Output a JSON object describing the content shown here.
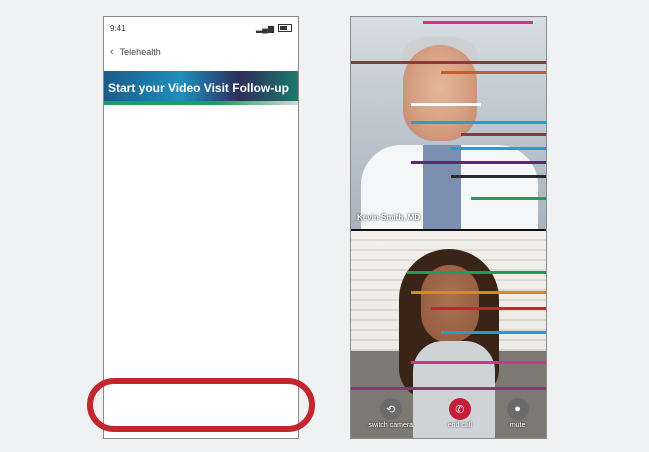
{
  "left_phone": {
    "status_time": "9:41",
    "app_title": "Telehealth",
    "banner_text": "Start your Video Visit Follow-up"
  },
  "right_phone": {
    "doctor_name": "Kevin Smith, MD",
    "controls": [
      {
        "label": "switch camera",
        "icon": "camera-switch-icon"
      },
      {
        "label": "end call",
        "icon": "phone-hangup-icon"
      },
      {
        "label": "mute",
        "icon": "mic-icon"
      }
    ]
  },
  "colors": {
    "highlight": "#c1272d",
    "end_call": "#c41e3a",
    "background": "#eff1f3"
  }
}
